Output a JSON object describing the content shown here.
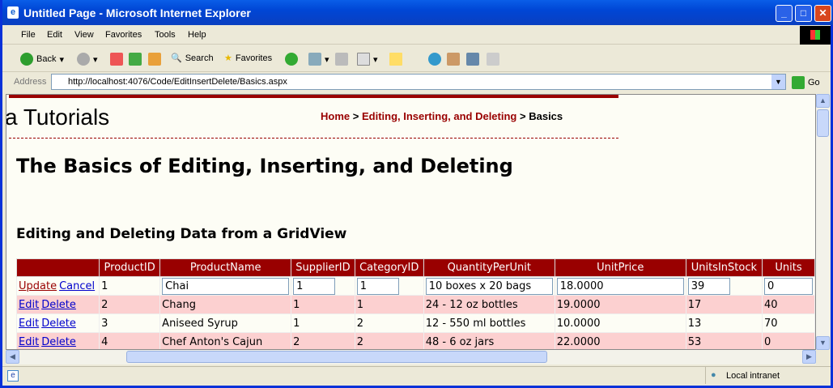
{
  "window": {
    "title": "Untitled Page - Microsoft Internet Explorer"
  },
  "menu": [
    "File",
    "Edit",
    "View",
    "Favorites",
    "Tools",
    "Help"
  ],
  "toolbar": {
    "back": "Back",
    "search": "Search",
    "favorites": "Favorites"
  },
  "address": {
    "label": "Address",
    "url": "http://localhost:4076/Code/EditInsertDelete/Basics.aspx",
    "go": "Go"
  },
  "page": {
    "site_title": "a Tutorials",
    "breadcrumb": {
      "home": "Home",
      "section": "Editing, Inserting, and Deleting",
      "sep": ">",
      "current": "Basics"
    },
    "heading": "The Basics of Editing, Inserting, and Deleting",
    "subheading": "Editing and Deleting Data from a GridView",
    "accent": "#990000"
  },
  "grid": {
    "columns": [
      "",
      "ProductID",
      "ProductName",
      "SupplierID",
      "CategoryID",
      "QuantityPerUnit",
      "UnitPrice",
      "UnitsInStock",
      "Units"
    ],
    "edit_row": {
      "update": "Update",
      "cancel": "Cancel",
      "ProductID": "1",
      "ProductName": "Chai",
      "SupplierID": "1",
      "CategoryID": "1",
      "QuantityPerUnit": "10 boxes x 20 bags",
      "UnitPrice": "18.0000",
      "UnitsInStock": "39",
      "Units": "0"
    },
    "rows": [
      {
        "edit": "Edit",
        "delete": "Delete",
        "cells": [
          "2",
          "Chang",
          "1",
          "1",
          "24 - 12 oz bottles",
          "19.0000",
          "17",
          "40"
        ]
      },
      {
        "edit": "Edit",
        "delete": "Delete",
        "cells": [
          "3",
          "Aniseed Syrup",
          "1",
          "2",
          "12 - 550 ml bottles",
          "10.0000",
          "13",
          "70"
        ]
      },
      {
        "edit": "Edit",
        "delete": "Delete",
        "cells": [
          "4",
          "Chef Anton's Cajun",
          "2",
          "2",
          "48 - 6 oz jars",
          "22.0000",
          "53",
          "0"
        ]
      }
    ]
  },
  "status": {
    "zone": "Local intranet"
  }
}
